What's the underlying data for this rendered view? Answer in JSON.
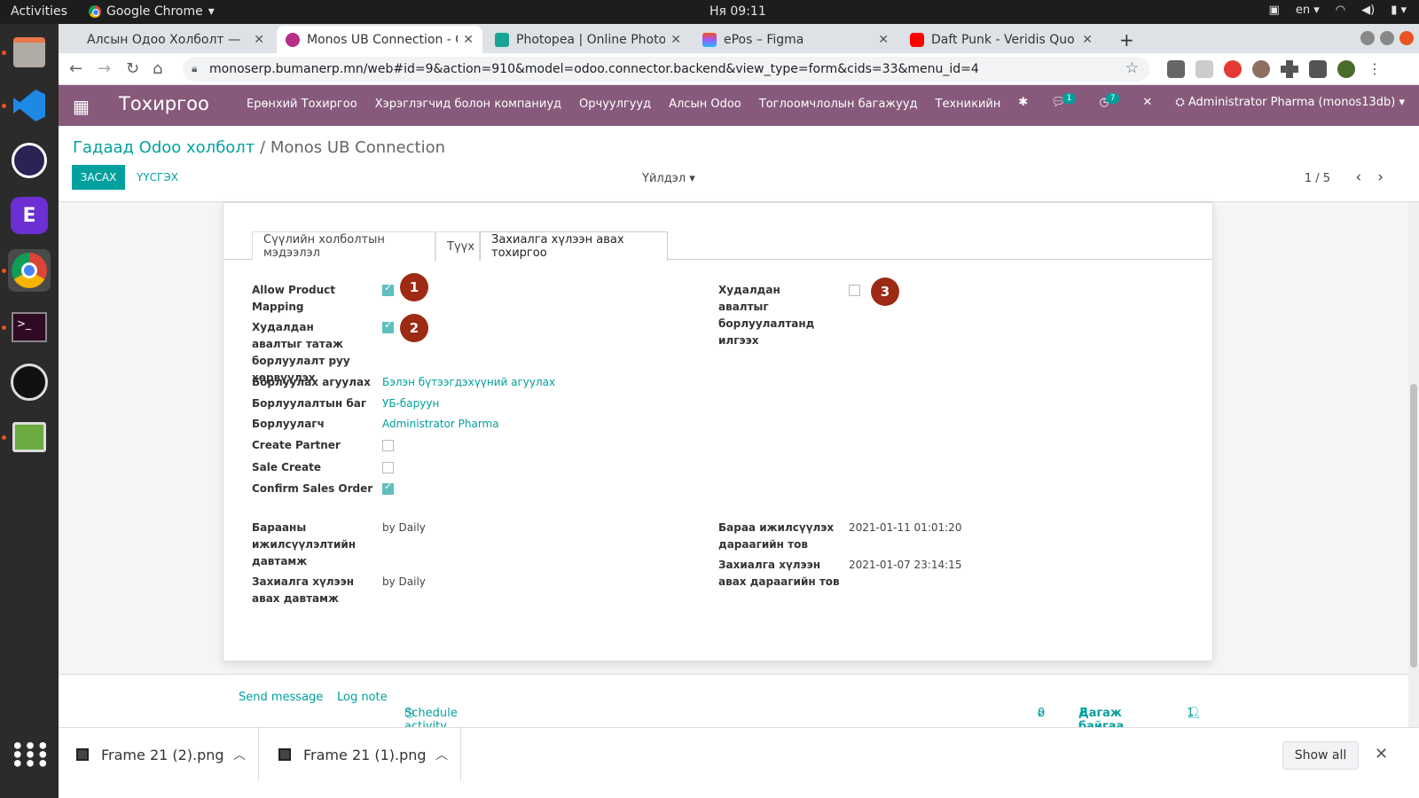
{
  "os": {
    "activities": "Activities",
    "app_name": "Google Chrome",
    "clock": "Ня 09:11",
    "lang": "en"
  },
  "browser": {
    "tabs": [
      {
        "title": "Алсын Одоо Холболт —",
        "color": "#2b2b2b"
      },
      {
        "title": "Monos UB Connection - O",
        "color": "#b62d8a"
      },
      {
        "title": "Photopea | Online Photo E",
        "color": "#18a497"
      },
      {
        "title": "ePos – Figma",
        "color": "#a259ff"
      },
      {
        "title": "Daft Punk - Veridis Quo",
        "color": "#ff0000"
      }
    ],
    "url": "monoserp.bumanerp.mn/web#id=9&action=910&model=odoo.connector.backend&view_type=form&cids=33&menu_id=4"
  },
  "odoo_nav": {
    "brand": "Тохиргоо",
    "menu": [
      "Ерөнхий Тохиргоо",
      "Хэрэглэгчид болон компаниуд",
      "Орчуулгууд",
      "Алсын Odoo",
      "Тоглоомчлолын багажууд",
      "Техникийн"
    ],
    "messages_count": "1",
    "activities_count": "7",
    "user": "Administrator Pharma (monos13db)"
  },
  "control_panel": {
    "breadcrumb_parent": "Гадаад Odoo холболт",
    "breadcrumb_sep": "/",
    "breadcrumb_current": "Monos UB Connection",
    "edit": "ЗАСАХ",
    "create": "ҮҮСГЭХ",
    "actions": "Үйлдэл",
    "pager": "1 / 5"
  },
  "form": {
    "tabs": [
      "Сүүлийн холболтын мэдээлэл",
      "Түүх",
      "Захиалга хүлээн авах тохиргоо"
    ],
    "allow_product_mapping_label": "Allow Product Mapping",
    "allow_product_mapping": true,
    "convert_purchase_label": "Худалдан авалтыг татаж борлуулалт руу хөрвүүлэх",
    "convert_purchase": true,
    "send_purchase_label": "Худалдан авалтыг борлуулалтанд илгээх",
    "send_purchase": false,
    "warehouse_label": "Борлуулах агуулах",
    "warehouse": "Бэлэн бүтээгдэхүүний агуулах",
    "team_label": "Борлуулалтын баг",
    "team": "УБ-баруун",
    "salesperson_label": "Борлуулагч",
    "salesperson": "Administrator Pharma",
    "create_partner_label": "Create Partner",
    "create_partner": false,
    "sale_create_label": "Sale Create",
    "sale_create": false,
    "confirm_so_label": "Confirm Sales Order",
    "confirm_so": true,
    "product_freq_label": "Барааны ижилсүүлэлтийн давтамж",
    "product_freq": "by Daily",
    "order_freq_label": "Захиалга хүлээн авах давтамж",
    "order_freq": "by Daily",
    "product_next_label": "Бараа ижилсүүлэх дараагийн тов",
    "product_next": "2021-01-11 01:01:20",
    "order_next_label": "Захиалга хүлээн авах дараагийн тов",
    "order_next": "2021-01-07 23:14:15",
    "markers": [
      "1",
      "2",
      "3"
    ]
  },
  "chatter": {
    "send_message": "Send message",
    "log_note": "Log note",
    "schedule": "Schedule activity",
    "attachments": "0",
    "follow": "Дагаж байгаа",
    "followers": "1"
  },
  "downloads": {
    "items": [
      "Frame 21 (2).png",
      "Frame 21 (1).png"
    ],
    "show_all": "Show all"
  },
  "colors": {
    "odoo_primary": "#875a7b",
    "odoo_teal": "#00a09d",
    "marker": "#9c2a14"
  }
}
